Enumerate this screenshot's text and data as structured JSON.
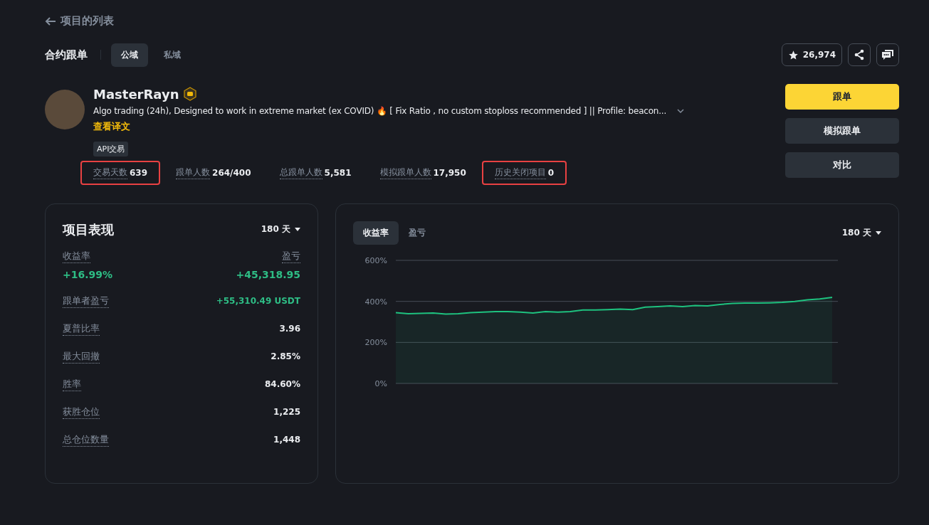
{
  "back_link": {
    "label": "项目的列表"
  },
  "header": {
    "title": "合约跟单",
    "tabs": [
      {
        "label": "公域",
        "selected": true
      },
      {
        "label": "私域",
        "selected": false
      }
    ],
    "favorites_count": "26,974"
  },
  "profile": {
    "name": "MasterRayn",
    "description": "Algo trading (24h), Designed to work in extreme market (ex COVID) 🔥 [ Fix Ratio , no custom stoploss recommended ] || Profile: beacon...",
    "translate_link": "查看译文",
    "tag": "API交易",
    "stats": [
      {
        "label": "交易天数",
        "value": "639",
        "highlighted": true
      },
      {
        "label": "跟单人数",
        "value": "264/400",
        "highlighted": false
      },
      {
        "label": "总跟单人数",
        "value": "5,581",
        "highlighted": false
      },
      {
        "label": "模拟跟单人数",
        "value": "17,950",
        "highlighted": false
      },
      {
        "label": "历史关闭项目",
        "value": "0",
        "highlighted": true
      }
    ]
  },
  "actions": [
    {
      "label": "跟单",
      "kind": "primary"
    },
    {
      "label": "模拟跟单",
      "kind": "secondary"
    },
    {
      "label": "对比",
      "kind": "secondary"
    }
  ],
  "performance": {
    "title": "项目表现",
    "period": "180 天",
    "roi_label": "收益率",
    "roi_value": "+16.99%",
    "pnl_label": "盈亏",
    "pnl_value": "+45,318.95",
    "metrics": [
      {
        "label": "跟单者盈亏",
        "value": "+55,310.49 USDT",
        "positive": true
      },
      {
        "label": "夏普比率",
        "value": "3.96",
        "positive": false
      },
      {
        "label": "最大回撤",
        "value": "2.85%",
        "positive": false
      },
      {
        "label": "胜率",
        "value": "84.60%",
        "positive": false
      },
      {
        "label": "获胜仓位",
        "value": "1,225",
        "positive": false
      },
      {
        "label": "总仓位数量",
        "value": "1,448",
        "positive": false
      }
    ]
  },
  "chart_panel": {
    "tabs": [
      {
        "label": "收益率",
        "selected": true
      },
      {
        "label": "盈亏",
        "selected": false
      }
    ],
    "period": "180 天",
    "chart_data": {
      "type": "area",
      "values": [
        345,
        340,
        342,
        343,
        338,
        340,
        345,
        348,
        350,
        350,
        348,
        343,
        350,
        348,
        350,
        358,
        358,
        360,
        362,
        360,
        372,
        375,
        378,
        375,
        380,
        378,
        385,
        390,
        392,
        392,
        393,
        395,
        400,
        408,
        412,
        420
      ],
      "ylim": [
        0,
        600
      ],
      "yticks": [
        {
          "value": 0,
          "label": "0%"
        },
        {
          "value": 200,
          "label": "200%"
        },
        {
          "value": 400,
          "label": "400%"
        },
        {
          "value": 600,
          "label": "600%"
        }
      ]
    }
  }
}
